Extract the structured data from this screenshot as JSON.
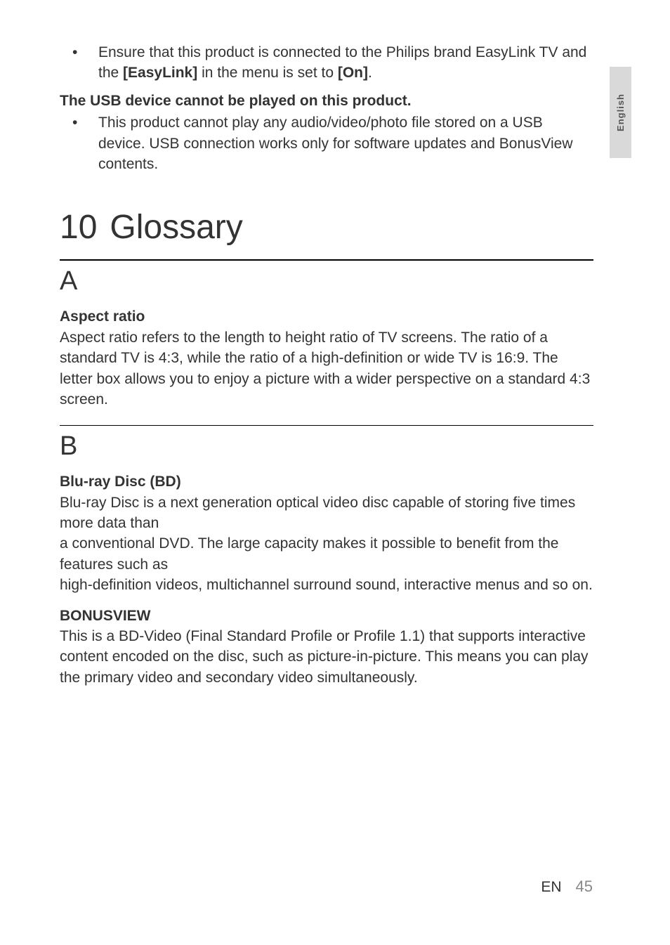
{
  "langTab": "English",
  "troubleshoot": {
    "bullet1_pre": "Ensure that this product is connected to the Philips brand EasyLink TV and the ",
    "bullet1_bold1": "[EasyLink]",
    "bullet1_mid": " in the menu is set to ",
    "bullet1_bold2": "[On]",
    "bullet1_end": ".",
    "heading2": "The USB device cannot be played on this product.",
    "bullet2": "This product cannot play any audio/video/photo file stored on a USB device. USB connection works only for software updates and BonusView contents."
  },
  "chapter": {
    "number": "10",
    "title": "Glossary"
  },
  "sections": [
    {
      "letter": "A",
      "entries": [
        {
          "term": "Aspect ratio",
          "definition": "Aspect ratio refers to the length to height ratio of TV screens. The ratio of a standard TV is 4:3, while the ratio of a high-definition or wide TV is 16:9. The letter box allows you to enjoy a picture with a wider perspective on a standard 4:3 screen."
        }
      ]
    },
    {
      "letter": "B",
      "entries": [
        {
          "term": "Blu-ray Disc (BD)",
          "definition": "Blu-ray Disc is a next generation optical video disc capable of storing five times more data than\na conventional DVD. The large capacity makes it possible to benefit from the features such as\nhigh-definition videos, multichannel surround sound, interactive menus and so on."
        },
        {
          "term": "BONUSVIEW",
          "definition": "This is a BD-Video (Final Standard Profile or Profile 1.1) that supports interactive content encoded on the disc, such as picture-in-picture. This means you can play the primary video and secondary video simultaneously."
        }
      ]
    }
  ],
  "footer": {
    "lang": "EN",
    "page": "45"
  }
}
